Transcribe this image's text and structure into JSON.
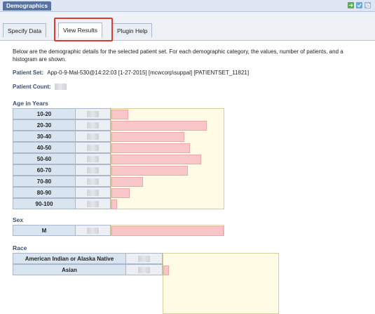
{
  "panel": {
    "title": "Demographics"
  },
  "tabs": [
    {
      "label": "Specify Data"
    },
    {
      "label": "View Results"
    },
    {
      "label": "Plugin Help"
    }
  ],
  "intro": "Below are the demographic details for the selected patient set. For each demographic category, the values, number of patients, and a histogram are shown.",
  "patient_set": {
    "label": "Patient Set:",
    "value": "App-0-9-Mal-530@14:22:03 [1-27-2015] [mcwcorp\\suppal] [PATIENTSET_11821]"
  },
  "patient_count": {
    "label": "Patient Count:"
  },
  "age": {
    "title": "Age in Years",
    "rows": [
      {
        "label": "10-20",
        "fraction": 0.15
      },
      {
        "label": "20-30",
        "fraction": 0.85
      },
      {
        "label": "30-40",
        "fraction": 0.65
      },
      {
        "label": "40-50",
        "fraction": 0.7
      },
      {
        "label": "50-60",
        "fraction": 0.8
      },
      {
        "label": "60-70",
        "fraction": 0.68
      },
      {
        "label": "70-80",
        "fraction": 0.28
      },
      {
        "label": "80-90",
        "fraction": 0.16
      },
      {
        "label": "90-100",
        "fraction": 0.05
      }
    ]
  },
  "sex": {
    "title": "Sex",
    "rows": [
      {
        "label": "M",
        "fraction": 1.0
      }
    ]
  },
  "race": {
    "title": "Race",
    "rows": [
      {
        "label": "American Indian or Alaska Native",
        "fraction": 0.0
      },
      {
        "label": "Asian",
        "fraction": 0.05
      }
    ]
  },
  "colors": {
    "header": "#5573a3",
    "bar": "#f7c6c8",
    "chart_bg": "#fffbe5",
    "highlight": "#e03a2f"
  },
  "icons": [
    "export-icon",
    "check-icon",
    "copy-icon"
  ]
}
